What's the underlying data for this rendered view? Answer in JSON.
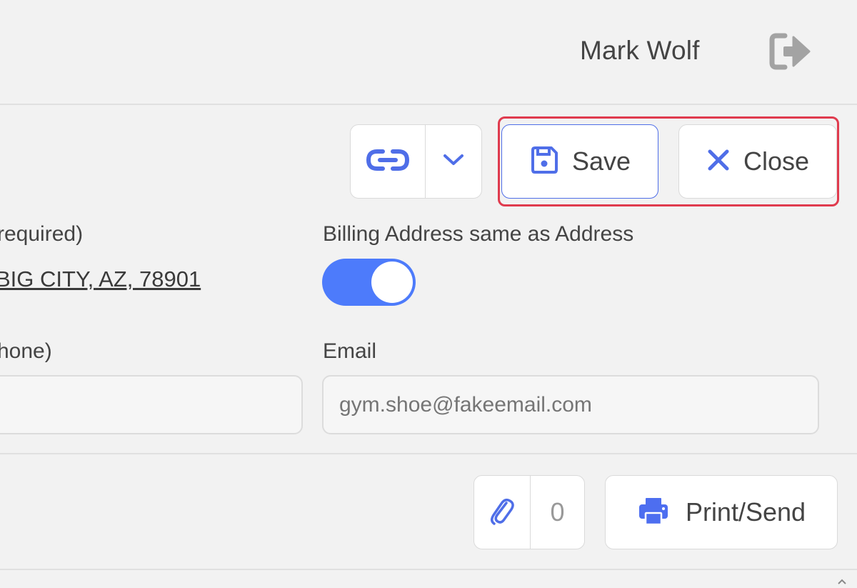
{
  "header": {
    "user_name": "Mark Wolf",
    "logout_icon": "sign-out-icon"
  },
  "toolbar": {
    "link_icon": "link-icon",
    "dropdown_icon": "chevron-down-icon",
    "save_label": "Save",
    "save_icon": "floppy-disk-icon",
    "close_label": "Close",
    "close_icon": "x-icon"
  },
  "form": {
    "address_label_partial": "required)",
    "address_value_partial": "BIG CITY, AZ, 78901",
    "billing_label": "Billing Address same as Address",
    "billing_same": true,
    "phone_label_partial": "hone)",
    "phone_value": "",
    "email_label": "Email",
    "email_placeholder": "gym.shoe@fakeemail.com"
  },
  "bottom_toolbar": {
    "attach_icon": "paperclip-icon",
    "attach_count": "0",
    "print_icon": "printer-icon",
    "print_label": "Print/Send"
  },
  "colors": {
    "accent": "#4d7bfb",
    "highlight": "#e03b4e",
    "background": "#f2f2f2"
  }
}
